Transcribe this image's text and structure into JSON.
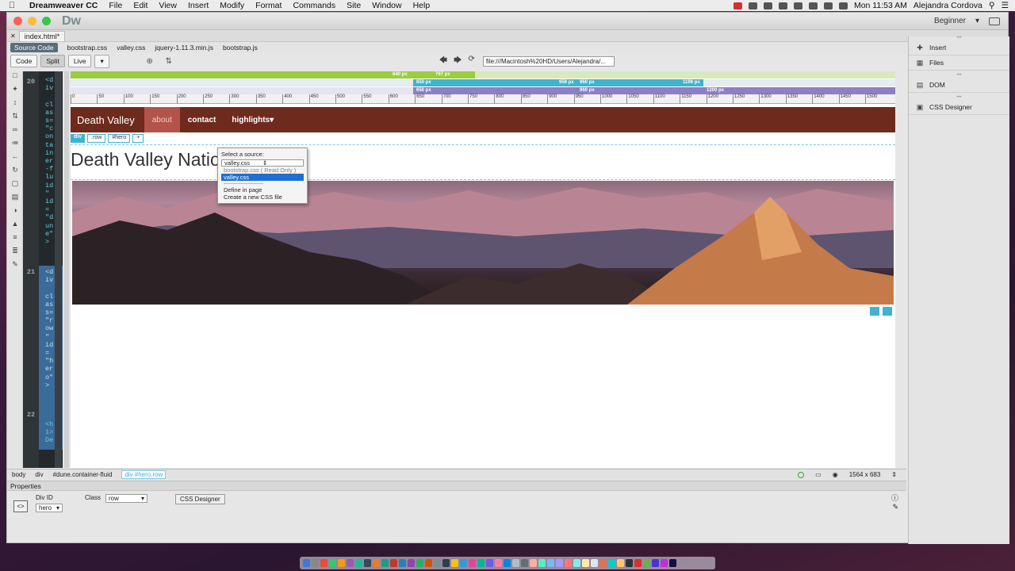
{
  "menubar": {
    "app_name": "Dreamweaver CC",
    "items": [
      "File",
      "Edit",
      "View",
      "Insert",
      "Modify",
      "Format",
      "Commands",
      "Site",
      "Window",
      "Help"
    ],
    "clock": "Mon 11:53 AM",
    "user": "Alejandra Cordova"
  },
  "window": {
    "logo": "Dw",
    "workspace": "Beginner",
    "doc_tab": "index.html*",
    "related_files": [
      "Source Code",
      "bootstrap.css",
      "valley.css",
      "jquery-1.11.3.min.js",
      "bootstrap.js"
    ],
    "url": "file:///Macintosh%20HD/Users/Alejandra/..."
  },
  "toolbar": {
    "code_label": "Code",
    "split_label": "Split",
    "live_label": "Live"
  },
  "code": {
    "line_numbers": [
      "20",
      "21",
      "22"
    ],
    "lines": "<d\niv\n\ncl\nas\ns=\n\"c\non\nta\nin\ner\n-f\nlu\nid\n\"\nid\n=\n\"d\nun\ne\"\n>",
    "lines2": "<d\niv\n\ncl\nas\ns=\n\"r\now\n\"\nid\n=\n\"h\ner\no\"\n>",
    "lines3": "<h\n1>\nDe"
  },
  "media_queries": {
    "mq1": [
      "640 px",
      "767 px"
    ],
    "mq2": [
      "650 px",
      "959 px",
      "960 px",
      "1199 px"
    ],
    "mq3": [
      "650 px",
      "960 px",
      "1200 px"
    ]
  },
  "ruler": [
    "0",
    "50",
    "100",
    "150",
    "200",
    "250",
    "300",
    "350",
    "400",
    "450",
    "500",
    "550",
    "600",
    "650",
    "700",
    "750",
    "800",
    "850",
    "900",
    "950",
    "1000",
    "1050",
    "1100",
    "1150",
    "1200",
    "1250",
    "1300",
    "1350",
    "1400",
    "1450",
    "1500"
  ],
  "page": {
    "brand": "Death Valley",
    "nav": [
      "about",
      "contact",
      "highlights"
    ],
    "heading": "Death Valley National Park",
    "selector_tag": "div",
    "selector_chips": [
      ".row",
      "#hero",
      "+"
    ]
  },
  "popup": {
    "label": "Select a source:",
    "selected": "valley.css",
    "options": [
      "bootstrap.css ( Read Only )",
      "valley.css"
    ],
    "options2": [
      "Define in page",
      "Create a new CSS file"
    ]
  },
  "right_panels": [
    "Insert",
    "Files",
    "DOM",
    "CSS Designer"
  ],
  "tag_selector": {
    "items": [
      "body",
      "div",
      "#dune.container-fluid"
    ],
    "current": "div #hero.row",
    "size": "1564 x 683"
  },
  "properties": {
    "title": "Properties",
    "div_id_label": "Div ID",
    "div_id_value": "hero",
    "class_label": "Class",
    "class_value": "row",
    "css_designer_btn": "CSS Designer"
  },
  "colors": {
    "navbar": "#6e2a1d",
    "nav_active": "#b2544a",
    "accent": "#3fb3cf",
    "mq_green": "#9acd40",
    "mq_purple": "#8f7fc4"
  }
}
